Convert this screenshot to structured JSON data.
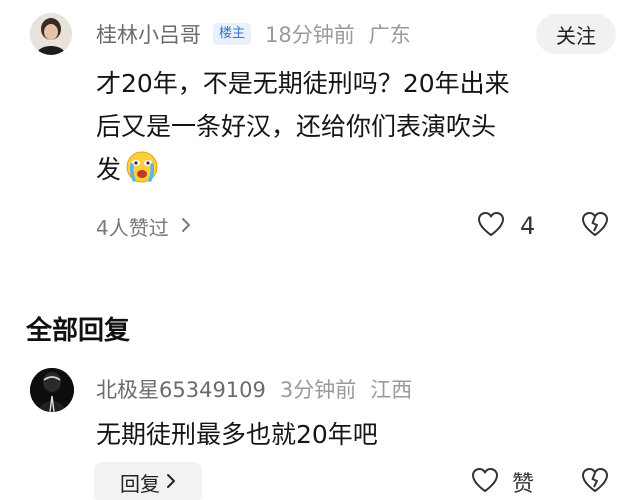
{
  "op_comment": {
    "author": "桂林小吕哥",
    "badge": "楼主",
    "time": "18分钟前",
    "location": "广东",
    "follow_label": "关注",
    "line1": "才20年，不是无期徒刑吗？20年出来",
    "line2": "后又是一条好汉，还给你们表演吹头",
    "line3": "发",
    "emoji": "crying-face-emoji",
    "likers_text": "4人赞过",
    "like_count": "4"
  },
  "section": {
    "title": "全部回复"
  },
  "reply": {
    "author": "北极星65349109",
    "time": "3分钟前",
    "location": "江西",
    "text": "无期徒刑最多也就20年吧",
    "reply_button_label": "回复",
    "like_label": "赞"
  },
  "colors": {
    "badge_text": "#3a74c9",
    "badge_bg": "#e8f0fb",
    "meta_gray": "#9a9a9a",
    "button_bg": "#f1f1f1"
  }
}
